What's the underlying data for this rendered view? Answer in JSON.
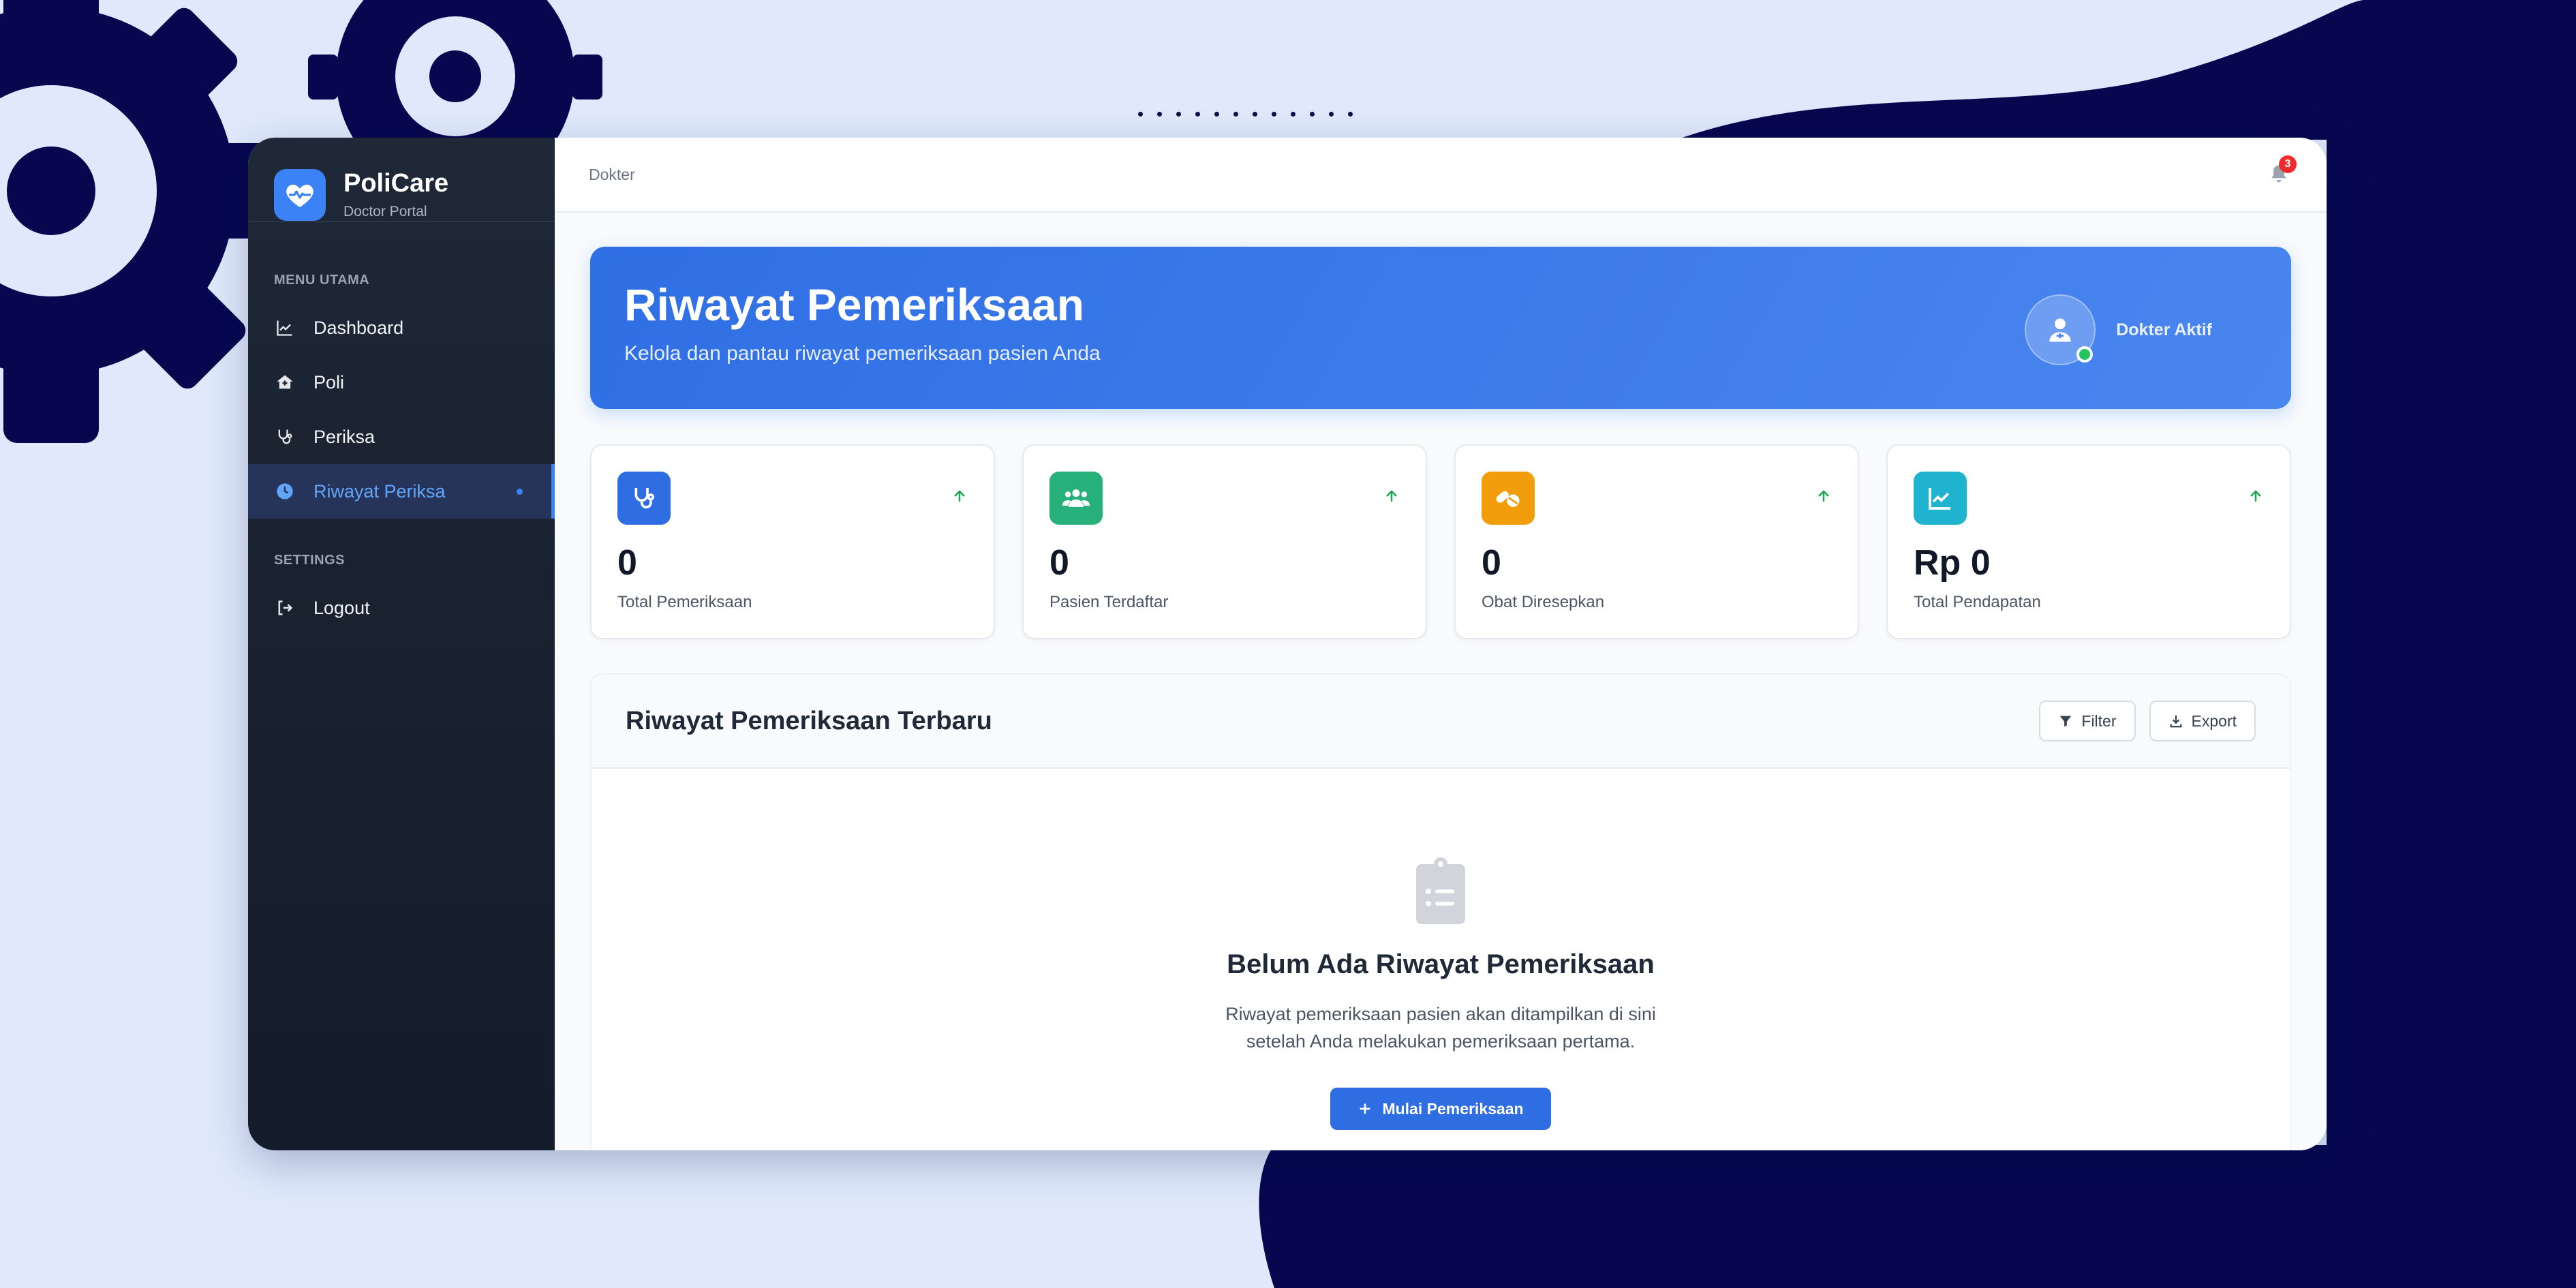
{
  "app": {
    "name": "PoliCare",
    "subtitle": "Doctor Portal"
  },
  "sidebar": {
    "main_section_label": "MENU UTAMA",
    "items": [
      {
        "label": "Dashboard",
        "icon": "chart-line-icon"
      },
      {
        "label": "Poli",
        "icon": "clinic-icon"
      },
      {
        "label": "Periksa",
        "icon": "stethoscope-icon"
      },
      {
        "label": "Riwayat Periksa",
        "icon": "clock-icon",
        "active": true
      }
    ],
    "settings_section_label": "SETTINGS",
    "logout_label": "Logout"
  },
  "topbar": {
    "breadcrumb": "Dokter",
    "notification_count": "3"
  },
  "hero": {
    "title": "Riwayat Pemeriksaan",
    "subtitle": "Kelola dan pantau riwayat pemeriksaan pasien Anda",
    "status_label": "Dokter Aktif"
  },
  "stats": [
    {
      "value": "0",
      "label": "Total Pemeriksaan",
      "icon": "stethoscope-icon",
      "color": "#2f6de3"
    },
    {
      "value": "0",
      "label": "Pasien Terdaftar",
      "icon": "users-icon",
      "color": "#27b07a"
    },
    {
      "value": "0",
      "label": "Obat Diresepkan",
      "icon": "pills-icon",
      "color": "#f29d0b"
    },
    {
      "value": "Rp 0",
      "label": "Total Pendapatan",
      "icon": "chart-line-icon",
      "color": "#1fb3cf"
    }
  ],
  "panel": {
    "title": "Riwayat Pemeriksaan Terbaru",
    "filter_label": "Filter",
    "export_label": "Export"
  },
  "empty_state": {
    "title": "Belum Ada Riwayat Pemeriksaan",
    "text_line1": "Riwayat pemeriksaan pasien akan ditampilkan di sini",
    "text_line2": "setelah Anda melakukan pemeriksaan pertama.",
    "button_label": "Mulai Pemeriksaan"
  },
  "colors": {
    "accent": "#3b82f6",
    "sidebar_bg": "#1b2332",
    "background": "#dfe9fb",
    "deco_navy": "#06074f",
    "trend_up": "#16a34a",
    "badge": "#ef2b2b"
  }
}
